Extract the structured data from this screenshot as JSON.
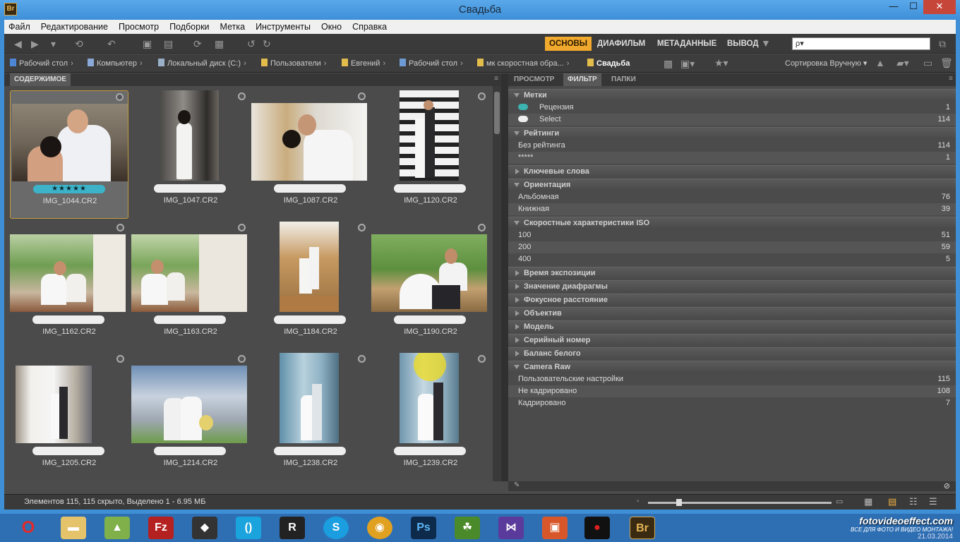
{
  "window": {
    "title": "Свадьба",
    "app_icon": "Br"
  },
  "menu": [
    "Файл",
    "Редактирование",
    "Просмотр",
    "Подборки",
    "Метка",
    "Инструменты",
    "Окно",
    "Справка"
  ],
  "workspaces": [
    {
      "label": "ОСНОВЫ",
      "active": true
    },
    {
      "label": "ДИАФИЛЬМ"
    },
    {
      "label": "МЕТАДАННЫЕ"
    },
    {
      "label": "ВЫВОД"
    }
  ],
  "search": {
    "placeholder": "ρ▾"
  },
  "breadcrumb": [
    "Рабочий стол",
    "Компьютер",
    "Локальный диск (C:)",
    "Пользователи",
    "Евгений",
    "Рабочий стол",
    "мк скоростная обра...",
    "Свадьба"
  ],
  "sort": {
    "label": "Сортировка Вручную ▾"
  },
  "content_panel": {
    "tab": "СОДЕРЖИМОЕ"
  },
  "thumbnails": [
    {
      "name": "IMG_1044.CR2",
      "rating": "★★★★★",
      "selected": true
    },
    {
      "name": "IMG_1047.CR2"
    },
    {
      "name": "IMG_1087.CR2"
    },
    {
      "name": "IMG_1120.CR2"
    },
    {
      "name": "IMG_1162.CR2"
    },
    {
      "name": "IMG_1163.CR2"
    },
    {
      "name": "IMG_1184.CR2"
    },
    {
      "name": "IMG_1190.CR2"
    },
    {
      "name": "IMG_1205.CR2"
    },
    {
      "name": "IMG_1214.CR2"
    },
    {
      "name": "IMG_1238.CR2"
    },
    {
      "name": "IMG_1239.CR2"
    }
  ],
  "right_tabs": [
    {
      "label": "ПРОСМОТР"
    },
    {
      "label": "ФИЛЬТР",
      "active": true
    },
    {
      "label": "ПАПКИ"
    }
  ],
  "filter": {
    "labels": {
      "title": "Метки",
      "items": [
        {
          "label": "Рецензия",
          "count": "1",
          "color": "#3cb3b0"
        },
        {
          "label": "Select",
          "count": "114",
          "color": "#eeeeee"
        }
      ]
    },
    "ratings": {
      "title": "Рейтинги",
      "items": [
        {
          "label": "Без рейтинга",
          "count": "114"
        },
        {
          "label": "*****",
          "count": "1"
        }
      ]
    },
    "keywords": {
      "title": "Ключевые слова"
    },
    "orientation": {
      "title": "Ориентация",
      "items": [
        {
          "label": "Альбомная",
          "count": "76"
        },
        {
          "label": "Книжная",
          "count": "39"
        }
      ]
    },
    "iso": {
      "title": "Скоростные характеристики ISO",
      "items": [
        {
          "label": "100",
          "count": "51"
        },
        {
          "label": "200",
          "count": "59"
        },
        {
          "label": "400",
          "count": "5"
        }
      ]
    },
    "collapsed": [
      "Время экспозиции",
      "Значение диафрагмы",
      "Фокусное расстояние",
      "Объектив",
      "Модель",
      "Серийный номер",
      "Баланс белого"
    ],
    "camera_raw": {
      "title": "Camera Raw",
      "items": [
        {
          "label": "Пользовательские настройки",
          "count": "115"
        },
        {
          "label": "Не кадрировано",
          "count": "108"
        },
        {
          "label": "Кадрировано",
          "count": "7"
        }
      ]
    }
  },
  "status": {
    "text": "Элементов 115, 115 скрыто, Выделено 1 - 6.95 МБ"
  },
  "tray": {
    "watermark": "fotovideoeffect.com",
    "watermark_sub": "ВСЕ ДЛЯ ФОТО И ВИДЕО МОНТАЖА!",
    "date": "21.03.2014"
  }
}
